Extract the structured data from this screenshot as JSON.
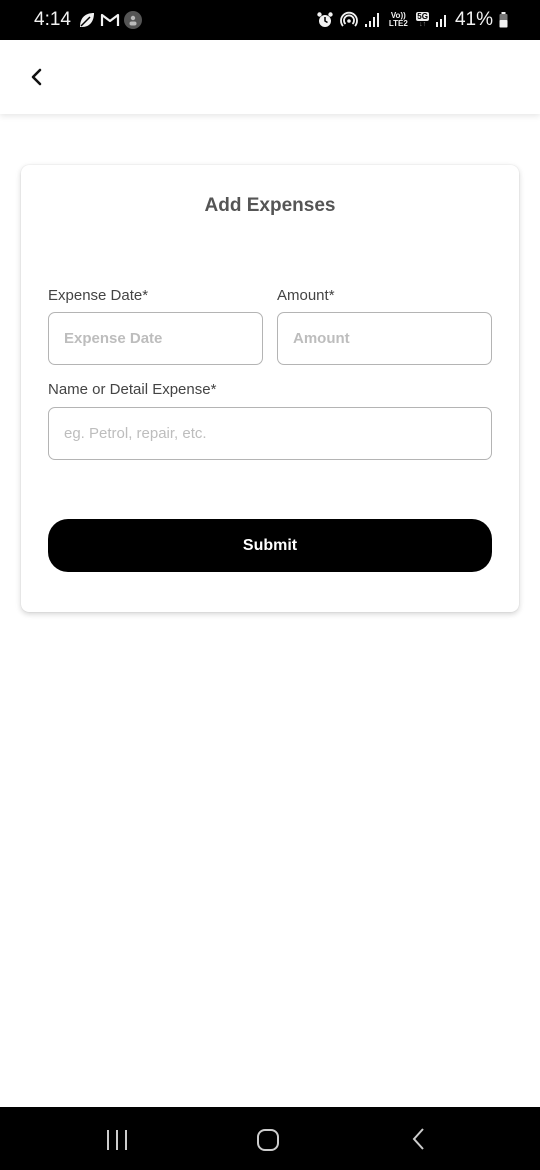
{
  "status_bar": {
    "time": "4:14",
    "left_icons": [
      "leaf-icon",
      "gmail-icon",
      "account-icon"
    ],
    "right_icons": [
      "alarm-icon",
      "hotspot-icon",
      "signal-icon",
      "volte-icon",
      "5g-icon",
      "signal-icon",
      "battery-icon"
    ],
    "volte_label": "Vo)) LTE2",
    "network_label": "5G",
    "battery": "41%"
  },
  "header": {
    "back_icon": "chevron-left-icon"
  },
  "form": {
    "title": "Add Expenses",
    "fields": {
      "expense_date": {
        "label": "Expense Date*",
        "placeholder": "Expense Date",
        "value": ""
      },
      "amount": {
        "label": "Amount*",
        "placeholder": "Amount",
        "value": ""
      },
      "detail": {
        "label": "Name or Detail Expense*",
        "placeholder": "eg. Petrol, repair, etc.",
        "value": ""
      }
    },
    "submit_label": "Submit"
  },
  "nav_bar": {
    "recents_icon": "recent-apps-icon",
    "home_icon": "home-icon",
    "back_icon": "back-icon"
  }
}
